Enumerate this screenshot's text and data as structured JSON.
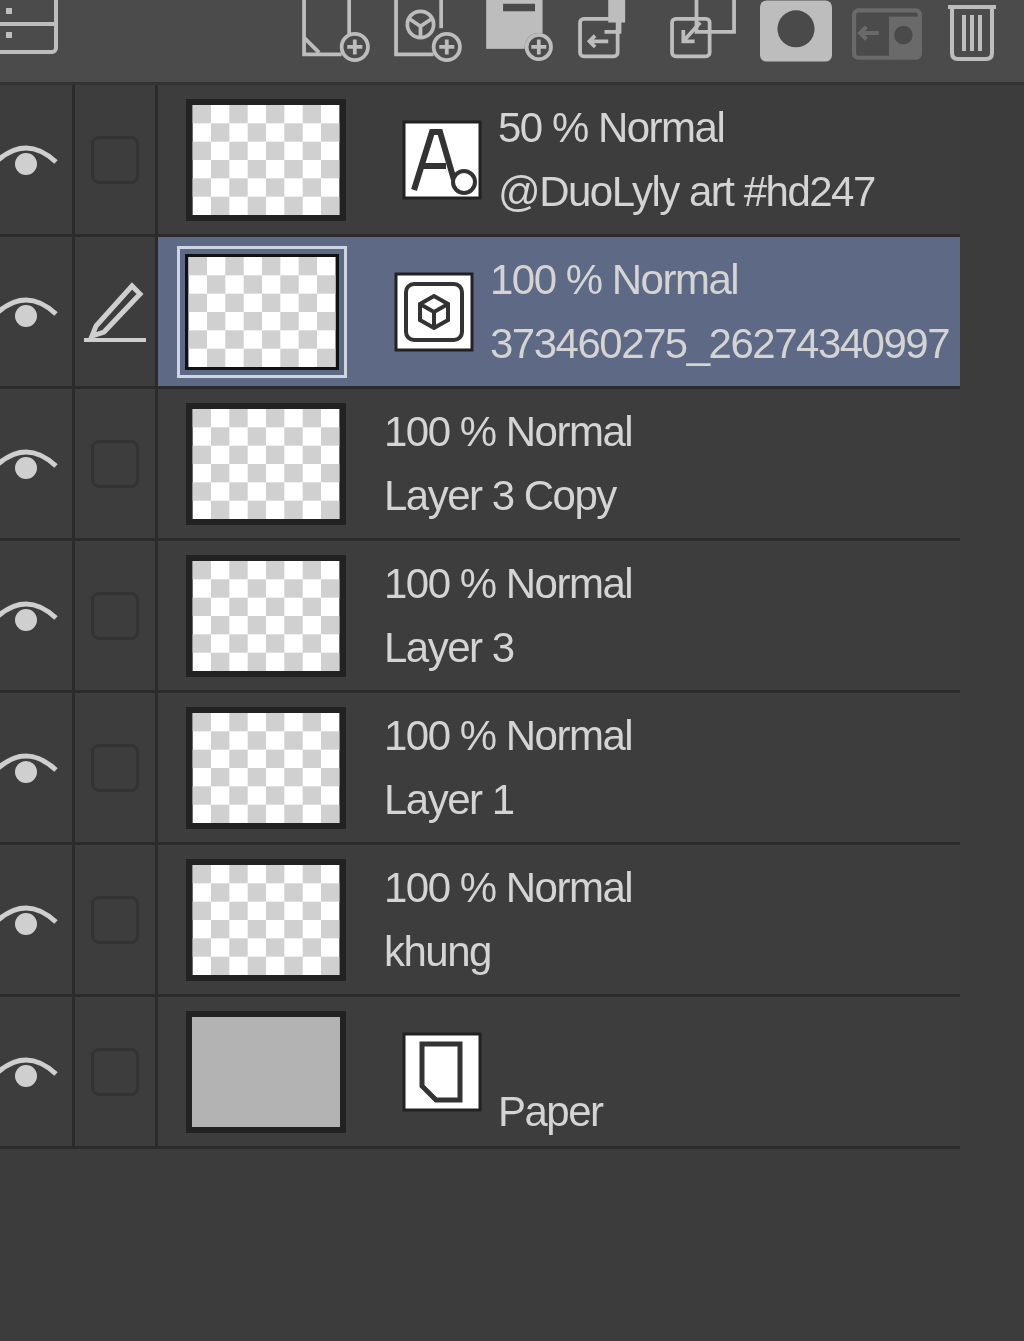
{
  "layers": [
    {
      "blend": "50 % Normal",
      "name": "@DuoLyly art #hd247",
      "kind": "text",
      "selected": false,
      "editing": false,
      "visible": true
    },
    {
      "blend": "100 % Normal",
      "name": "373460275_26274340997",
      "kind": "model",
      "selected": true,
      "editing": true,
      "visible": true
    },
    {
      "blend": "100 % Normal",
      "name": "Layer 3 Copy",
      "kind": "raster",
      "selected": false,
      "editing": false,
      "visible": true
    },
    {
      "blend": "100 % Normal",
      "name": "Layer 3",
      "kind": "raster",
      "selected": false,
      "editing": false,
      "visible": true
    },
    {
      "blend": "100 % Normal",
      "name": "Layer 1",
      "kind": "raster",
      "selected": false,
      "editing": false,
      "visible": true
    },
    {
      "blend": "100 % Normal",
      "name": "khung",
      "kind": "raster",
      "selected": false,
      "editing": false,
      "visible": true
    },
    {
      "name": "Paper",
      "kind": "paper",
      "selected": false,
      "editing": false,
      "visible": true
    }
  ]
}
